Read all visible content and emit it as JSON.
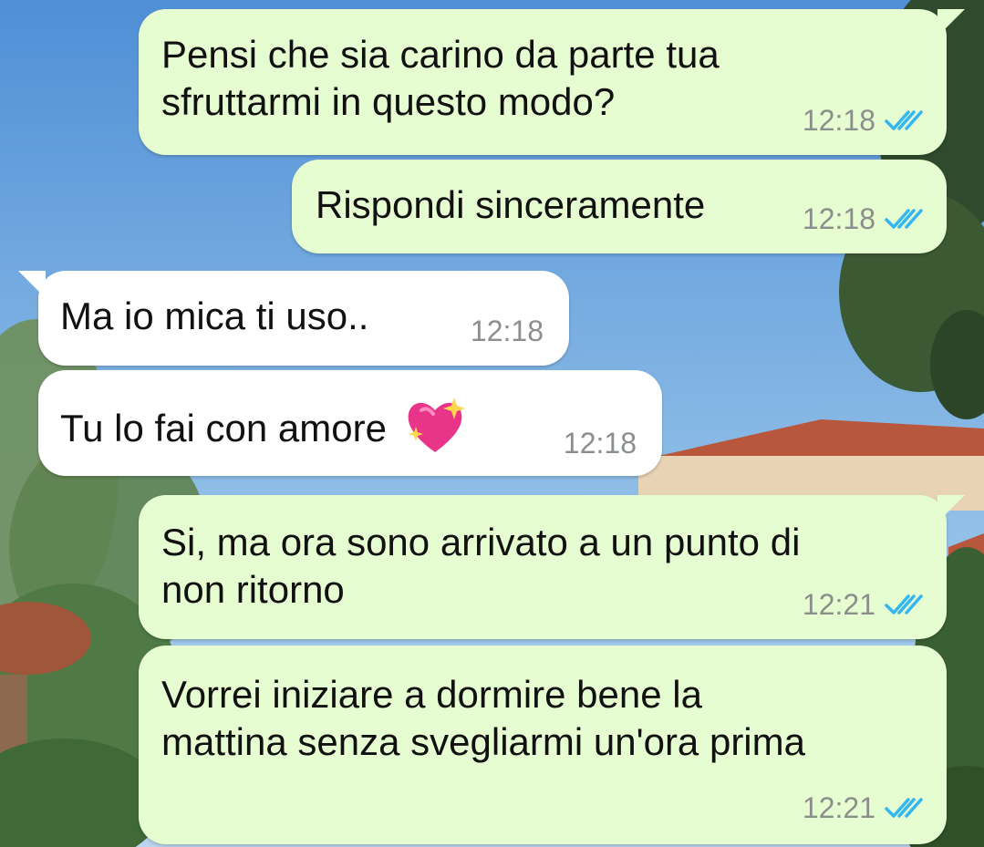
{
  "colors": {
    "outgoing_bubble": "#e6fdd1",
    "incoming_bubble": "#ffffff",
    "read_ticks": "#34b7f1",
    "timestamp": "#8a8f8c"
  },
  "icons": {
    "read_receipt": "double-check-icon",
    "emoji": "sparkling-heart-icon"
  },
  "messages": [
    {
      "direction": "out",
      "lines": [
        "Pensi che sia carino da parte tua",
        "sfruttarmi in questo modo?"
      ],
      "time": "12:18",
      "status": "read"
    },
    {
      "direction": "out",
      "lines": [
        "Rispondi sinceramente"
      ],
      "time": "12:18",
      "status": "read"
    },
    {
      "direction": "in",
      "lines": [
        "Ma io mica ti uso.."
      ],
      "time": "12:18"
    },
    {
      "direction": "in",
      "lines": [
        "Tu lo fai con amore"
      ],
      "emoji": "💖",
      "time": "12:18"
    },
    {
      "direction": "out",
      "lines": [
        "Si, ma ora sono arrivato a un punto di",
        "non ritorno"
      ],
      "time": "12:21",
      "status": "read"
    },
    {
      "direction": "out",
      "lines": [
        "Vorrei iniziare a dormire bene la",
        "mattina senza svegliarmi un'ora prima"
      ],
      "time": "12:21",
      "status": "read"
    }
  ]
}
